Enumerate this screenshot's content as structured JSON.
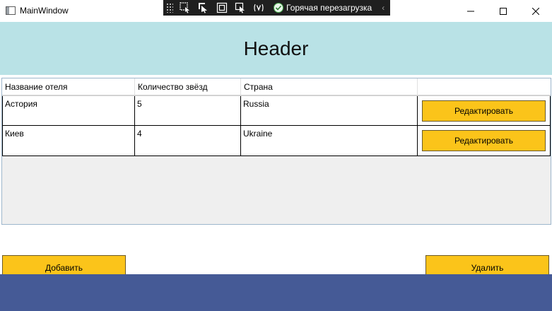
{
  "window": {
    "title": "MainWindow",
    "minimize_icon": "minimize-icon",
    "maximize_icon": "maximize-icon",
    "close_icon": "close-icon"
  },
  "debug_toolbar": {
    "hot_reload_label": "Горячая перезагрузка",
    "icons": [
      "select-element-icon",
      "pointer-icon",
      "display-layout-icon",
      "track-focus-icon",
      "binding-failures-icon",
      "hot-reload-check-icon",
      "collapse-chevron-icon"
    ]
  },
  "header": {
    "title": "Header",
    "background": "#b9e2e6"
  },
  "table": {
    "columns": [
      "Название отеля",
      "Количество звёзд",
      "Страна",
      ""
    ],
    "rows": [
      {
        "name": "Астория",
        "stars": "5",
        "country": "Russia",
        "action": "Редактировать"
      },
      {
        "name": "Киев",
        "stars": "4",
        "country": "Ukraine",
        "action": "Редактировать"
      }
    ]
  },
  "actions": {
    "add_label": "Добавить",
    "delete_label": "Удалить"
  },
  "colors": {
    "button": "#fbc41a",
    "footer": "#455a96",
    "header": "#b9e2e6"
  }
}
